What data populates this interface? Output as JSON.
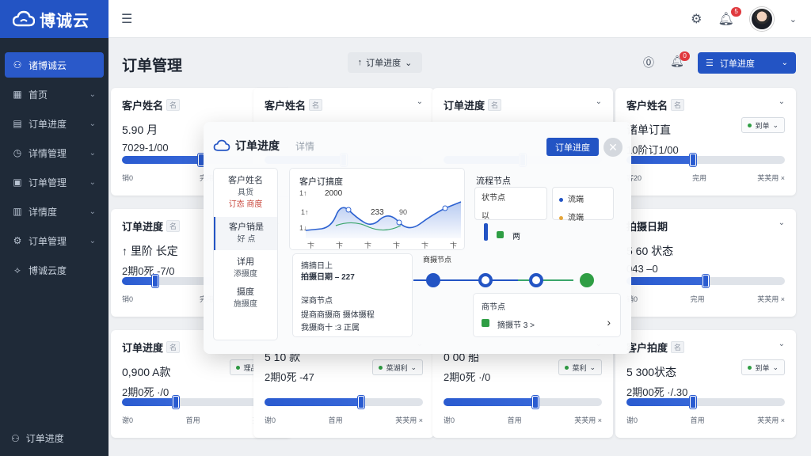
{
  "brand": {
    "name": "博诚云"
  },
  "sidebar": {
    "items": [
      {
        "icon": "people-icon",
        "glyph": "⚇",
        "label": "诸博诚云",
        "active": true,
        "chevron": false
      },
      {
        "icon": "grid-icon",
        "glyph": "▦",
        "label": "首页",
        "active": false,
        "chevron": true
      },
      {
        "icon": "document-icon",
        "glyph": "▤",
        "label": "订单进度",
        "active": false,
        "chevron": true
      },
      {
        "icon": "clock-icon",
        "glyph": "◷",
        "label": "详情管理",
        "active": false,
        "chevron": true
      },
      {
        "icon": "box-icon",
        "glyph": "▣",
        "label": "订单管理",
        "active": false,
        "chevron": true
      },
      {
        "icon": "file-icon",
        "glyph": "▥",
        "label": "详情度",
        "active": false,
        "chevron": true
      },
      {
        "icon": "gear-icon",
        "glyph": "⚙",
        "label": "订单管理",
        "active": false,
        "chevron": true
      },
      {
        "icon": "network-icon",
        "glyph": "⟡",
        "label": "博诚云度",
        "active": false,
        "chevron": false
      }
    ],
    "footer_label": "订单进度"
  },
  "topbar": {
    "notification_count": "5"
  },
  "page": {
    "title": "订单管理",
    "progress_select": "订单进度",
    "primary_button": "订单进度",
    "header_badge": "0"
  },
  "cards": [
    {
      "title": "客户姓名",
      "tag": "名",
      "main": "5.90 月",
      "sub": "7029-1/00",
      "pill": "",
      "fill": 0.5,
      "left": "销0",
      "mid": "完用",
      "right": "",
      "col": 0,
      "row": 0
    },
    {
      "title": "客户姓名",
      "tag": "名",
      "main": "",
      "sub": "",
      "pill": "",
      "fill": 0.5,
      "left": "",
      "mid": "",
      "right": "",
      "col": 1,
      "row": 0
    },
    {
      "title": "订单进度",
      "tag": "名",
      "main": "",
      "sub": "",
      "pill": "",
      "fill": 0.5,
      "left": "",
      "mid": "",
      "right": "",
      "col": 2,
      "row": 0
    },
    {
      "title": "客户姓名",
      "tag": "名",
      "main": "诸单订直",
      "sub": "10阶订1/00",
      "pill": "到单",
      "fill": 0.42,
      "left": "客20",
      "mid": "完用",
      "right": "芙芙用 ×",
      "col": 3,
      "row": 0
    },
    {
      "title": "订单进度",
      "tag": "名",
      "main": "↑ 里阶 长定",
      "sub": "2期0死 -7/0",
      "pill": "",
      "fill": 0.21,
      "left": "销0",
      "mid": "完用",
      "right": "",
      "col": 0,
      "row": 1
    },
    {
      "title": "拍摄日期",
      "tag": "",
      "main": "5 60 状态",
      "sub": "043 –0",
      "pill": "",
      "fill": 0.5,
      "left": "销0",
      "mid": "完用",
      "right": "芙芙用 ×",
      "col": 3,
      "row": 1
    },
    {
      "title": "订单进度",
      "tag": "名",
      "main": "0,900 A款",
      "sub": "2期0死 ·/0",
      "pill": "理品物",
      "fill": 0.34,
      "left": "谢0",
      "mid": "首用",
      "right": "芙芙用 ×",
      "col": 0,
      "row": 2
    },
    {
      "title": "",
      "tag": "",
      "main": "5 10 款",
      "sub": "2期0死 -47",
      "pill": "菜湖利",
      "fill": 0.61,
      "left": "谢0",
      "mid": "首用",
      "right": "芙芙用 ×",
      "col": 1,
      "row": 2
    },
    {
      "title": "",
      "tag": "",
      "main": "0 00 船",
      "sub": "2期0死 ·/0",
      "pill": "菜利",
      "fill": 0.58,
      "left": "谢0",
      "mid": "首用",
      "right": "芙芙用 ×",
      "col": 2,
      "row": 2
    },
    {
      "title": "客户拍度",
      "tag": "名",
      "main": "5 300状态",
      "sub": "2期00死 ·/.30",
      "pill": "到单",
      "fill": 0.42,
      "left": "谢0",
      "mid": "首用",
      "right": "芙芙用 ×",
      "col": 3,
      "row": 2
    }
  ],
  "dialog": {
    "title": "订单进度",
    "subtitle": "详情",
    "primary": "订单进度",
    "left_list": [
      {
        "label": "客户姓名",
        "sub": "具货",
        "sub2": "订态 商度",
        "selected": false
      },
      {
        "label": "客户销是",
        "sub": "好 点",
        "sub2": "",
        "selected": true
      },
      {
        "label": "详用",
        "sub": "添摄度",
        "sub2": "",
        "selected": false
      },
      {
        "label": "摄度",
        "sub": "施摄度",
        "sub2": "",
        "selected": false
      }
    ],
    "chart": {
      "title": "客户订搞度",
      "annotations": [
        "2000",
        "233",
        "90"
      ],
      "yticks": [
        "1↑",
        "1↑",
        "1↓"
      ],
      "xticks": [
        "卞",
        "卞",
        "卞",
        "卞",
        "卞",
        "卞"
      ]
    },
    "nodes_title": "流程节点",
    "nodes_left_label": "状节点",
    "nodes_left_sub": "以",
    "legend": [
      {
        "label": "流端",
        "color": "#2354c4"
      },
      {
        "label": "流端",
        "color": "#e5a63a"
      }
    ],
    "nodes_bottom": "两",
    "info_title": "摘摘日上",
    "info_value": "拍摄日期 – 227",
    "info_sub": "深商节点",
    "info_line1": "提商商摄商 摄体摄程",
    "info_line2": "我摄商十 :3 正属",
    "timeline_label": "商摄节点",
    "node_box_title": "商节点",
    "node_box_text": "摘摄节 3 >"
  }
}
